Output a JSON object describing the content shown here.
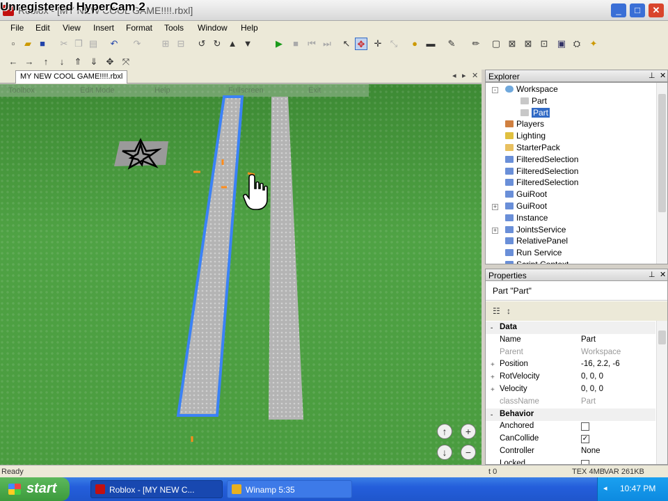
{
  "window": {
    "watermark": "Unregistered HyperCam 2",
    "title": "Roblox - [MY NEW COOL GAME!!!!.rbxl]",
    "minimize": "_",
    "maximize": "□",
    "close": "✕"
  },
  "menu": [
    "File",
    "Edit",
    "View",
    "Insert",
    "Format",
    "Tools",
    "Window",
    "Help"
  ],
  "document_tab": "MY NEW COOL GAME!!!!.rbxl",
  "viewport_toolbar_ghost": [
    "Toolbox",
    "Edit Mode",
    "Help",
    "Fullscreen",
    "Exit"
  ],
  "explorer": {
    "title": "Explorer",
    "items": [
      {
        "label": "Workspace",
        "indent": 0,
        "expander": "-",
        "icon": "globe-icon",
        "color": "#6fa8dc"
      },
      {
        "label": "Part",
        "indent": 1,
        "expander": "",
        "icon": "part-icon",
        "color": "#c8c8c8"
      },
      {
        "label": "Part",
        "indent": 1,
        "expander": "",
        "icon": "part-icon",
        "color": "#c8c8c8",
        "selected": true
      },
      {
        "label": "Players",
        "indent": 0,
        "expander": "",
        "icon": "players-icon",
        "color": "#d08040"
      },
      {
        "label": "Lighting",
        "indent": 0,
        "expander": "",
        "icon": "lighting-icon",
        "color": "#e0c040"
      },
      {
        "label": "StarterPack",
        "indent": 0,
        "expander": "",
        "icon": "folder-icon",
        "color": "#e8c060"
      },
      {
        "label": "FilteredSelection",
        "indent": 0,
        "expander": "",
        "icon": "service-icon",
        "color": "#6a8fd8"
      },
      {
        "label": "FilteredSelection",
        "indent": 0,
        "expander": "",
        "icon": "service-icon",
        "color": "#6a8fd8"
      },
      {
        "label": "FilteredSelection",
        "indent": 0,
        "expander": "",
        "icon": "service-icon",
        "color": "#6a8fd8"
      },
      {
        "label": "GuiRoot",
        "indent": 0,
        "expander": "",
        "icon": "service-icon",
        "color": "#6a8fd8"
      },
      {
        "label": "GuiRoot",
        "indent": 0,
        "expander": "+",
        "icon": "service-icon",
        "color": "#6a8fd8"
      },
      {
        "label": "Instance",
        "indent": 0,
        "expander": "",
        "icon": "service-icon",
        "color": "#6a8fd8"
      },
      {
        "label": "JointsService",
        "indent": 0,
        "expander": "+",
        "icon": "service-icon",
        "color": "#6a8fd8"
      },
      {
        "label": "RelativePanel",
        "indent": 0,
        "expander": "",
        "icon": "service-icon",
        "color": "#6a8fd8"
      },
      {
        "label": "Run Service",
        "indent": 0,
        "expander": "",
        "icon": "service-icon",
        "color": "#6a8fd8"
      },
      {
        "label": "Script Context",
        "indent": 0,
        "expander": "",
        "icon": "service-icon",
        "color": "#6a8fd8"
      }
    ]
  },
  "properties": {
    "title": "Properties",
    "subtitle": "Part \"Part\"",
    "rows": [
      {
        "type": "category",
        "key": "Data",
        "exp": "-"
      },
      {
        "type": "prop",
        "key": "Name",
        "value": "Part"
      },
      {
        "type": "prop",
        "key": "Parent",
        "value": "Workspace",
        "grey": true
      },
      {
        "type": "prop",
        "key": "Position",
        "value": "-16, 2.2, -6",
        "exp": "+"
      },
      {
        "type": "prop",
        "key": "RotVelocity",
        "value": "0, 0, 0",
        "exp": "+"
      },
      {
        "type": "prop",
        "key": "Velocity",
        "value": "0, 0, 0",
        "exp": "+"
      },
      {
        "type": "prop",
        "key": "className",
        "value": "Part",
        "grey": true
      },
      {
        "type": "category",
        "key": "Behavior",
        "exp": "-"
      },
      {
        "type": "check",
        "key": "Anchored",
        "checked": false
      },
      {
        "type": "check",
        "key": "CanCollide",
        "checked": true
      },
      {
        "type": "prop",
        "key": "Controller",
        "value": "None"
      },
      {
        "type": "check",
        "key": "Locked",
        "checked": false
      }
    ]
  },
  "status": {
    "left": "Ready",
    "mid": "t 0",
    "tex": "TEX 4MB",
    "var": "VAR 261KB"
  },
  "taskbar": {
    "start": "start",
    "items": [
      "Roblox - [MY NEW C...",
      "Winamp 5:35"
    ],
    "clock": "10:47 PM"
  },
  "colors": {
    "grass": "#4a9a3e",
    "selection": "#3b82f6",
    "brick": "#b9b9b9"
  }
}
